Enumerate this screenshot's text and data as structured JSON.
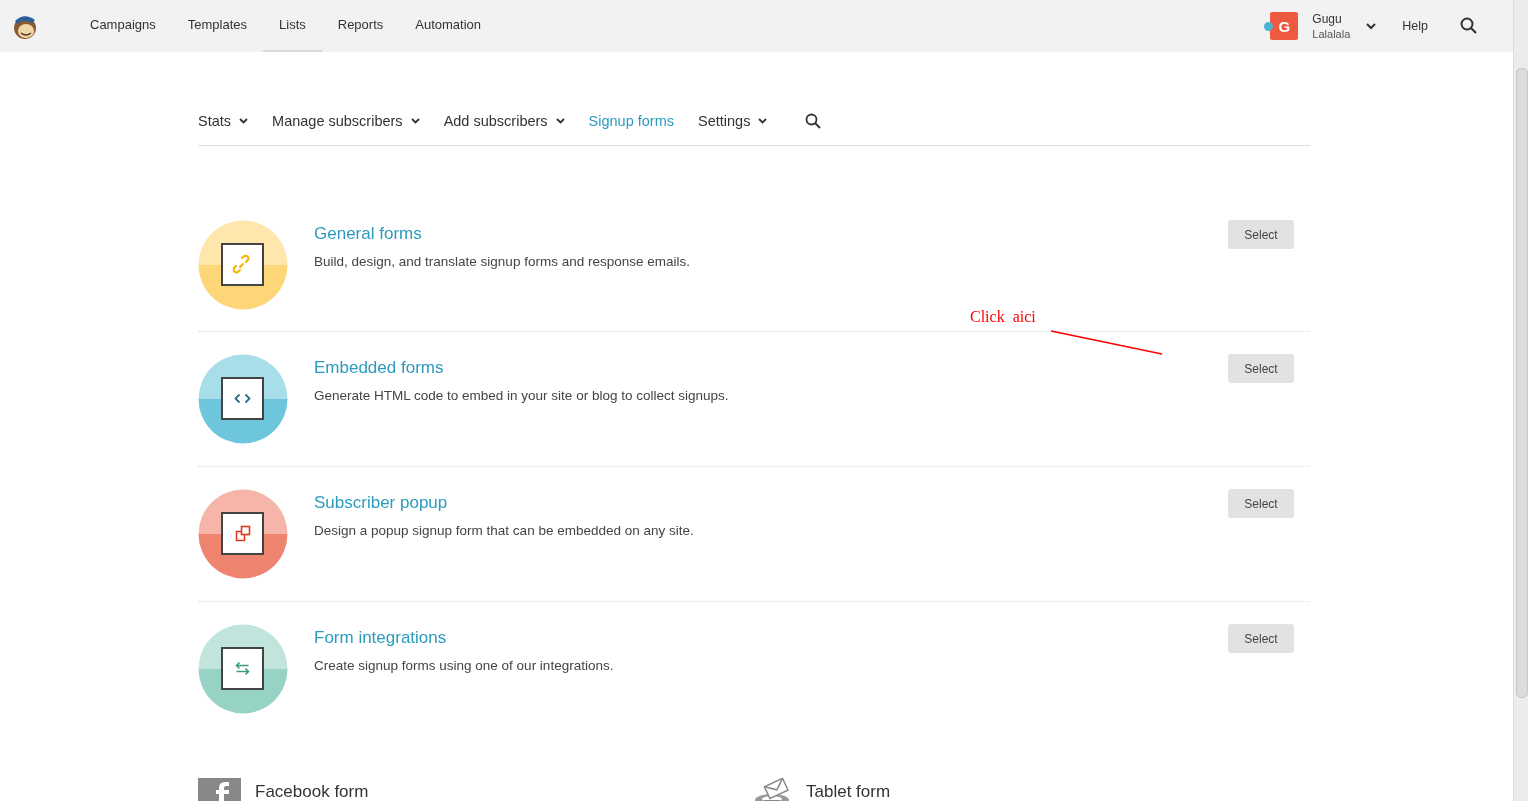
{
  "top_nav": {
    "items": [
      {
        "label": "Campaigns",
        "selected": false
      },
      {
        "label": "Templates",
        "selected": false
      },
      {
        "label": "Lists",
        "selected": true
      },
      {
        "label": "Reports",
        "selected": false
      },
      {
        "label": "Automation",
        "selected": false
      }
    ],
    "account": {
      "initial": "G",
      "online": true,
      "name": "Gugu",
      "subtitle": "Lalalala"
    },
    "help": "Help"
  },
  "sub_nav": [
    {
      "label": "Stats",
      "dropdown": true,
      "selected": false
    },
    {
      "label": "Manage subscribers",
      "dropdown": true,
      "selected": false
    },
    {
      "label": "Add subscribers",
      "dropdown": true,
      "selected": false
    },
    {
      "label": "Signup forms",
      "dropdown": false,
      "selected": true
    },
    {
      "label": "Settings",
      "dropdown": true,
      "selected": false
    }
  ],
  "form_types": [
    {
      "kind": "link",
      "title": "General forms",
      "description": "Build, design, and translate signup forms and response emails.",
      "button": "Select",
      "color": "#fdd677"
    },
    {
      "kind": "code",
      "title": "Embedded forms",
      "description": "Generate HTML code to embed in your site or blog to collect signups.",
      "button": "Select",
      "color": "#6ec6dc"
    },
    {
      "kind": "popup",
      "title": "Subscriber popup",
      "description": "Design a popup signup form that can be embedded on any site.",
      "button": "Select",
      "color": "#ee8370"
    },
    {
      "kind": "swap",
      "title": "Form integrations",
      "description": "Create signup forms using one of our integrations.",
      "button": "Select",
      "color": "#97d3c5"
    }
  ],
  "other_forms": [
    {
      "kind": "facebook",
      "title": "Facebook form"
    },
    {
      "kind": "tablet",
      "title": "Tablet form"
    }
  ],
  "annotation": {
    "text": "Click  aici"
  }
}
